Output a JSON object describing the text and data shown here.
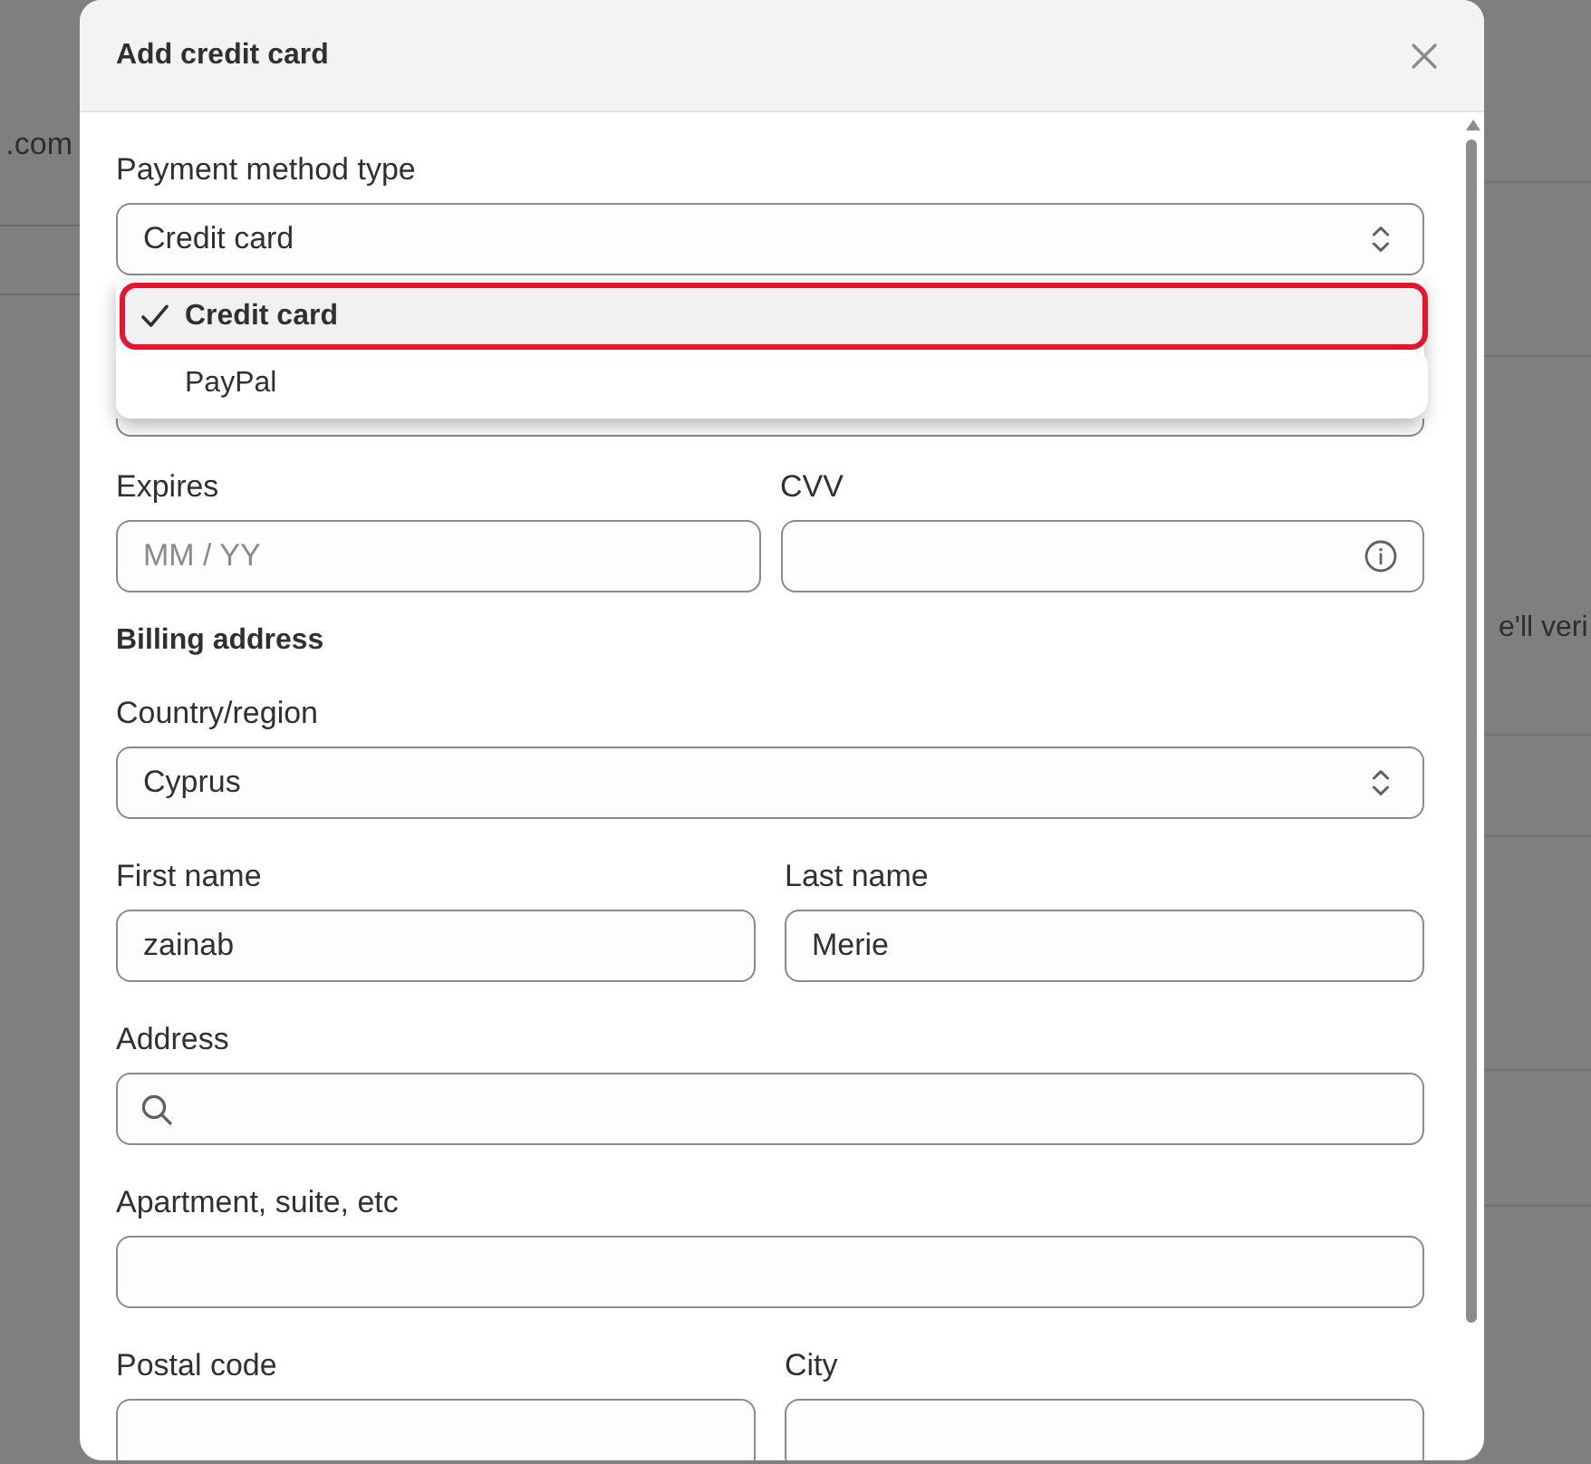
{
  "backdrop": {
    "left_text": ".com",
    "right_text": "e'll veri"
  },
  "dialog": {
    "title": "Add credit card"
  },
  "payment_method": {
    "label": "Payment method type",
    "value": "Credit card",
    "expanded": true,
    "options": [
      {
        "label": "Credit card",
        "selected": true,
        "highlighted": true
      },
      {
        "label": "PayPal",
        "selected": false,
        "highlighted": false
      }
    ]
  },
  "expires": {
    "label": "Expires",
    "placeholder": "MM / YY"
  },
  "cvv": {
    "label": "CVV"
  },
  "billing_address": {
    "heading": "Billing address",
    "country": {
      "label": "Country/region",
      "value": "Cyprus"
    },
    "first_name": {
      "label": "First name",
      "value": "zainab"
    },
    "last_name": {
      "label": "Last name",
      "value": "Merie"
    },
    "address": {
      "label": "Address"
    },
    "apartment": {
      "label": "Apartment, suite, etc"
    },
    "postal_code": {
      "label": "Postal code"
    },
    "city": {
      "label": "City"
    }
  }
}
